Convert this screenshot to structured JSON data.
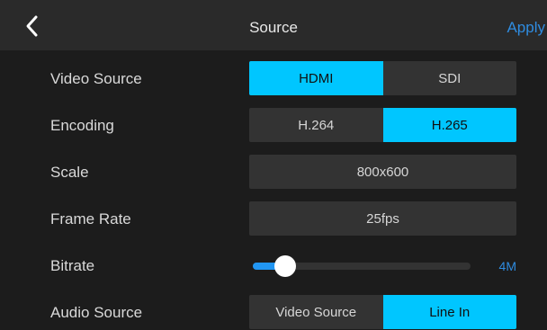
{
  "header": {
    "title": "Source",
    "apply_label": "Apply",
    "back_icon": "chevron-left-icon"
  },
  "settings": {
    "video_source": {
      "label": "Video Source",
      "options": [
        "HDMI",
        "SDI"
      ],
      "selected": "HDMI"
    },
    "encoding": {
      "label": "Encoding",
      "options": [
        "H.264",
        "H.265"
      ],
      "selected": "H.265"
    },
    "scale": {
      "label": "Scale",
      "value": "800x600"
    },
    "frame_rate": {
      "label": "Frame Rate",
      "value": "25fps"
    },
    "bitrate": {
      "label": "Bitrate",
      "value": "4M",
      "level": 0.15
    },
    "audio_source": {
      "label": "Audio Source",
      "options": [
        "Video Source",
        "Line In"
      ],
      "selected": "Line In"
    }
  },
  "colors": {
    "accent": "#00c6ff",
    "link": "#2f8ce0",
    "slider_fill": "#2196f3",
    "background": "#1c1c1c",
    "header_bg": "#2a2a2a",
    "control_bg": "#333333"
  }
}
